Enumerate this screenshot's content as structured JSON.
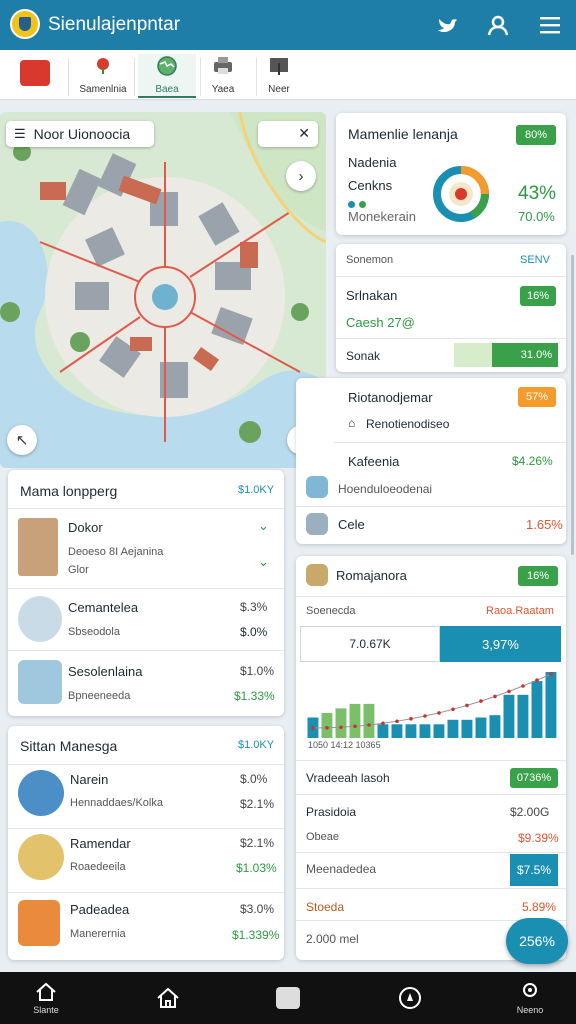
{
  "header": {
    "title": "Sienulajenpntar"
  },
  "tabs": [
    {
      "label": ""
    },
    {
      "label": "Samenlnia"
    },
    {
      "label": "Baea"
    },
    {
      "label": "Yaea"
    },
    {
      "label": "Neer"
    }
  ],
  "map": {
    "search_label": "Noor Uionoocia"
  },
  "card1": {
    "title": "Mamenlie lenanja",
    "badge": "80%",
    "row1": "Nadenia",
    "row2": "Cenkns",
    "row3": "Monekerain",
    "val1": "43%",
    "val2": "70.0%"
  },
  "card2": {
    "header_left": "Sonemon",
    "header_right": "SENV",
    "row1_label": "Srlnakan",
    "row1_badge": "16%",
    "row2_label": "Caesh 27@",
    "row3_label": "Sonak",
    "row3_value": "31.0%"
  },
  "card3": {
    "title": "Riotanodjemar",
    "badge": "57%",
    "row1": "Renotienodiseo",
    "row2": "Kafeenia",
    "row2_value": "$4.26%",
    "row3": "Hoenduloeodenai",
    "row4": "Cele",
    "row4_value": "1.65%"
  },
  "card4": {
    "title": "Mama lonpperg",
    "header_value": "$1.0KY",
    "items": [
      {
        "title": "Dokor",
        "sub": "Deoeso 8I Aejanina",
        "sub2": "Glor",
        "v1": "",
        "v2": ""
      },
      {
        "title": "Cemantelea",
        "sub": "Sbseodola",
        "v1": "$.3%",
        "v2": "$.0%"
      },
      {
        "title": "Sesolenlaina",
        "sub": "Bpneeneeda",
        "v1": "$1.0%",
        "v2": "$1.33%"
      }
    ]
  },
  "card5": {
    "title": "Sittan Manesga",
    "header_value": "$1.0KY",
    "items": [
      {
        "title": "Narein",
        "sub": "Hennaddaes/Kolka",
        "v1": "$.0%",
        "v2": "$2.1%"
      },
      {
        "title": "Ramendar",
        "sub": "Roaedeeila",
        "v1": "$2.1%",
        "v2": "$1.03%"
      },
      {
        "title": "Padeadea",
        "sub": "Manerernia",
        "v1": "$3.0%",
        "v2": "$1.339%"
      }
    ]
  },
  "card6": {
    "title": "Romajanora",
    "badge": "16%",
    "sub_left": "Soenecda",
    "sub_right": "Raoa.Raatam",
    "tab_left": "7.0.67K",
    "tab_right": "3,97%",
    "x_label": "1050 14:12 10365",
    "chart_data": {
      "type": "bar",
      "values": [
        18,
        22,
        26,
        30,
        30,
        12,
        12,
        12,
        12,
        12,
        16,
        16,
        18,
        20,
        38,
        38,
        50,
        58
      ]
    },
    "row1": "Vradeeah lasoh",
    "row1_badge": "0736%",
    "row2": "Prasidoia",
    "row2_value": "$2.00G",
    "row3": "Obeae",
    "row3_value": "$9.39%",
    "row4": "Meenadedea",
    "row4_value": "$7.5%",
    "row5": "Stoeda",
    "row5_value": "5.89%",
    "row6": "2.000 mel"
  },
  "fab": {
    "label": "256%"
  },
  "bottom_nav": [
    {
      "label": "Slante"
    },
    {
      "label": ""
    },
    {
      "label": ""
    },
    {
      "label": ""
    },
    {
      "label": "Neeno"
    }
  ]
}
